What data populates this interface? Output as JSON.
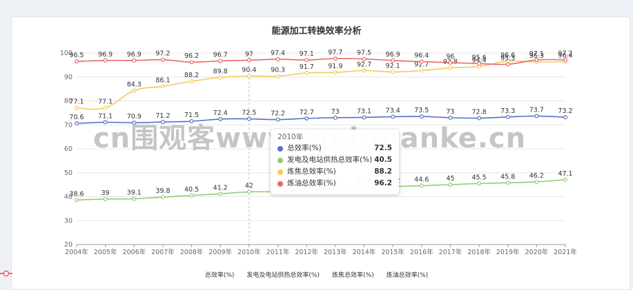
{
  "chart_data": {
    "type": "line",
    "title": "能源加工转换效率分析",
    "categories": [
      "2004年",
      "2005年",
      "2006年",
      "2007年",
      "2008年",
      "2009年",
      "2010年",
      "2011年",
      "2012年",
      "2013年",
      "2014年",
      "2015年",
      "2016年",
      "2017年",
      "2018年",
      "2019年",
      "2020年",
      "2021年"
    ],
    "ylim": [
      20,
      100
    ],
    "yticks": [
      "20",
      "30",
      "40",
      "50",
      "60",
      "70",
      "80",
      "90",
      "100"
    ],
    "grid": true,
    "legend_position": "bottom",
    "series": [
      {
        "name": "总效率(%)",
        "color": "#5470c6",
        "values": [
          70.6,
          71.1,
          70.9,
          71.2,
          71.5,
          72.4,
          72.5,
          72.2,
          72.7,
          73,
          73.1,
          73.4,
          73.5,
          73,
          72.8,
          73.3,
          73.7,
          73.2
        ]
      },
      {
        "name": "发电及电站供热总效率(%)",
        "color": "#91cc75",
        "values": [
          38.6,
          39,
          39.1,
          39.8,
          40.5,
          41.2,
          42,
          42.1,
          42.9,
          43.4,
          43.6,
          44.2,
          44.6,
          45,
          45.5,
          45.8,
          46.2,
          47.1
        ]
      },
      {
        "name": "炼焦总效率(%)",
        "color": "#fac858",
        "values": [
          77.1,
          77.1,
          84.3,
          86.1,
          88.2,
          89.8,
          90.4,
          90.3,
          91.7,
          91.9,
          92.7,
          92.1,
          92.7,
          93.8,
          94.4,
          96.6,
          96.3,
          96.4
        ]
      },
      {
        "name": "炼油总效率(%)",
        "color": "#ee6666",
        "values": [
          96.5,
          96.9,
          96.9,
          97.2,
          96.2,
          96.7,
          97,
          97.4,
          97.1,
          97.7,
          97.5,
          96.9,
          96.4,
          96,
          95.6,
          95.3,
          97.1,
          97.2
        ]
      }
    ]
  },
  "tooltip": {
    "header": "2010年",
    "rows": [
      {
        "label": "总效率(%)",
        "value": "72.5",
        "color": "#5470c6"
      },
      {
        "label": "发电及电站供热总效率(%)",
        "value": "40.5",
        "color": "#91cc75"
      },
      {
        "label": "炼焦总效率(%)",
        "value": "88.2",
        "color": "#fac858"
      },
      {
        "label": "炼油总效率(%)",
        "value": "96.2",
        "color": "#ee6666"
      }
    ]
  },
  "watermark": "cn围观客www.weiguanke.cn"
}
